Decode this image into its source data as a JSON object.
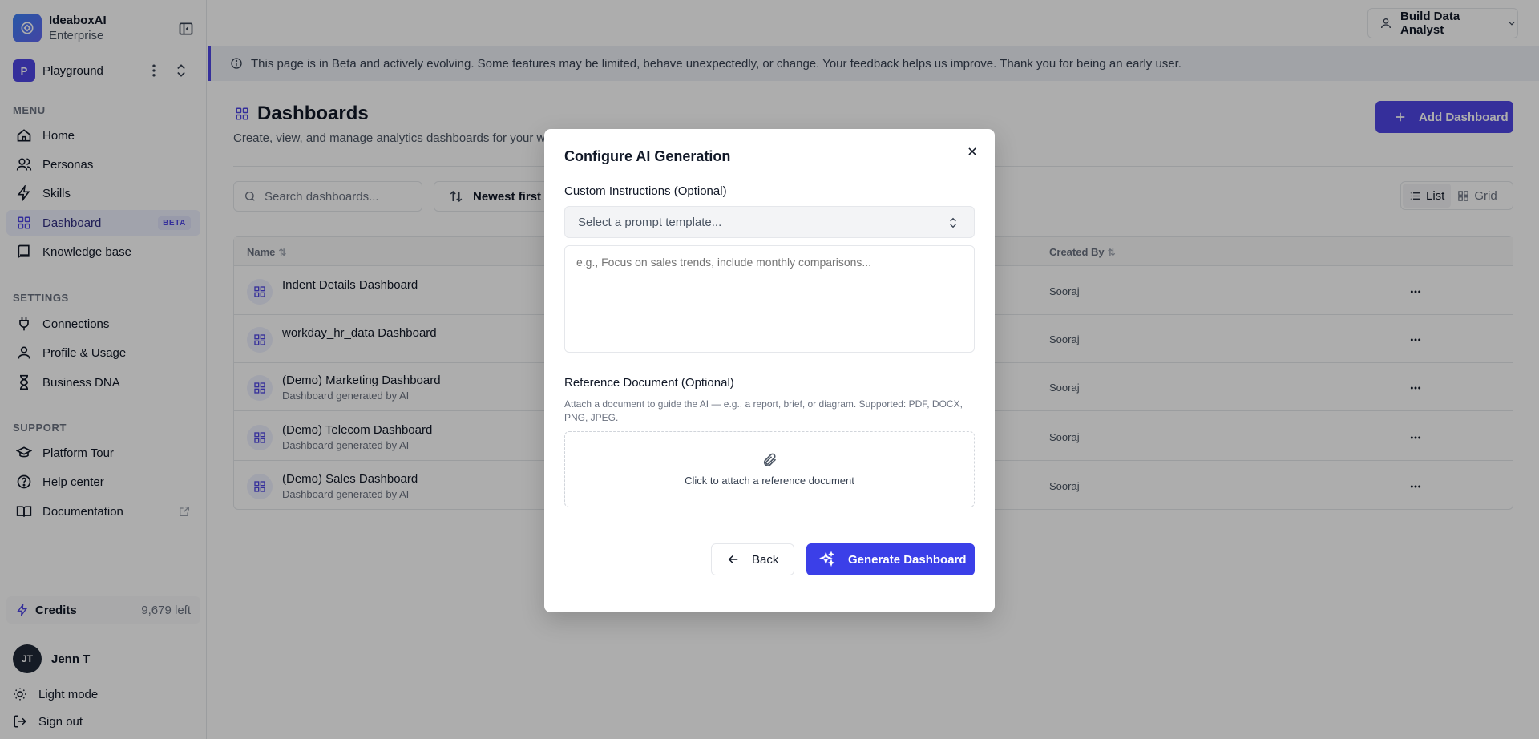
{
  "brand": {
    "name": "IdeaboxAI",
    "sub": "Enterprise"
  },
  "workspace": {
    "initial": "P",
    "name": "Playground"
  },
  "sidebar": {
    "menu_label": "MENU",
    "menu": [
      {
        "label": "Home",
        "icon": "home-icon"
      },
      {
        "label": "Personas",
        "icon": "users-icon"
      },
      {
        "label": "Skills",
        "icon": "bolt-icon"
      },
      {
        "label": "Dashboard",
        "icon": "grid-icon",
        "badge": "BETA",
        "active": true
      },
      {
        "label": "Knowledge base",
        "icon": "book-icon"
      }
    ],
    "settings_label": "SETTINGS",
    "settings": [
      {
        "label": "Connections",
        "icon": "plug-icon"
      },
      {
        "label": "Profile & Usage",
        "icon": "user-icon"
      },
      {
        "label": "Business DNA",
        "icon": "hourglass-icon"
      }
    ],
    "support_label": "SUPPORT",
    "support": [
      {
        "label": "Platform Tour",
        "icon": "graduation-cap-icon"
      },
      {
        "label": "Help center",
        "icon": "help-circle-icon"
      },
      {
        "label": "Documentation",
        "icon": "book-open-icon"
      }
    ],
    "credits": {
      "label": "Credits",
      "value": "9,679 left"
    },
    "user": {
      "initials": "JT",
      "name": "Jenn T"
    },
    "light_mode": "Light mode",
    "sign_out": "Sign out"
  },
  "header": {
    "persona_button": "Build Data Analyst"
  },
  "banner": "This page is in Beta and actively evolving. Some features may be limited, behave unexpectedly, or change. Your feedback helps us improve. Thank you for being an early user.",
  "page": {
    "title": "Dashboards",
    "subtitle": "Create, view, and manage analytics dashboards for your w",
    "add_button": "Add Dashboard",
    "search_placeholder": "Search dashboards...",
    "sort_label": "Newest first",
    "view_list": "List",
    "view_grid": "Grid"
  },
  "table": {
    "col_name": "Name",
    "col_created_by": "Created By",
    "rows": [
      {
        "name": "Indent Details Dashboard",
        "desc": "",
        "created_by": "Sooraj"
      },
      {
        "name": "workday_hr_data Dashboard",
        "desc": "",
        "created_by": "Sooraj"
      },
      {
        "name": "(Demo) Marketing Dashboard",
        "desc": "Dashboard generated by AI",
        "created_by": "Sooraj"
      },
      {
        "name": "(Demo) Telecom Dashboard",
        "desc": "Dashboard generated by AI",
        "created_by": "Sooraj"
      },
      {
        "name": "(Demo) Sales Dashboard",
        "desc": "Dashboard generated by AI",
        "created_by": "Sooraj"
      }
    ]
  },
  "modal": {
    "title": "Configure AI Generation",
    "instructions_label": "Custom Instructions (Optional)",
    "template_placeholder": "Select a prompt template...",
    "textarea_placeholder": "e.g., Focus on sales trends, include monthly comparisons...",
    "reference_label": "Reference Document (Optional)",
    "reference_help": "Attach a document to guide the AI — e.g., a report, brief, or diagram. Supported: PDF, DOCX, PNG, JPEG.",
    "attach_text": "Click to attach a reference document",
    "back_button": "Back",
    "generate_button": "Generate Dashboard"
  },
  "colors": {
    "accent": "#4f46e5",
    "primary_button": "#3b3fe8"
  }
}
